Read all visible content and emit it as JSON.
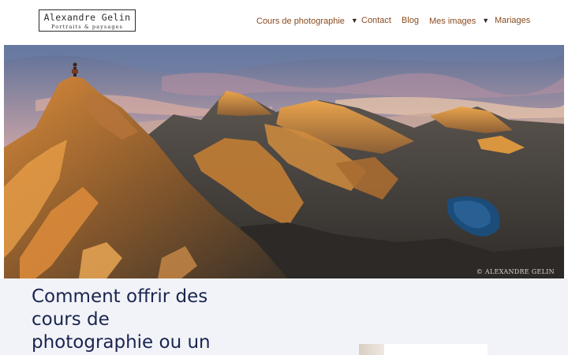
{
  "header": {
    "logo": {
      "name": "Alexandre Gelin",
      "tagline": "Portraits & paysages"
    },
    "nav": [
      {
        "label": "Cours de photographie",
        "has_dropdown": true,
        "icon": "caret-down-icon"
      },
      {
        "label": "Contact",
        "has_dropdown": false
      },
      {
        "label": "Blog",
        "has_dropdown": false
      },
      {
        "label": "Mes images",
        "has_dropdown": true,
        "icon": "caret-down-icon"
      },
      {
        "label": "Mariages",
        "has_dropdown": false
      }
    ],
    "nav_color": "#8a4a1d"
  },
  "hero": {
    "watermark": "© ALEXANDRE GELIN"
  },
  "article": {
    "title": "Comment offrir des cours de photographie ou un",
    "title_color": "#1a2550",
    "background": "#f2f3f8"
  }
}
